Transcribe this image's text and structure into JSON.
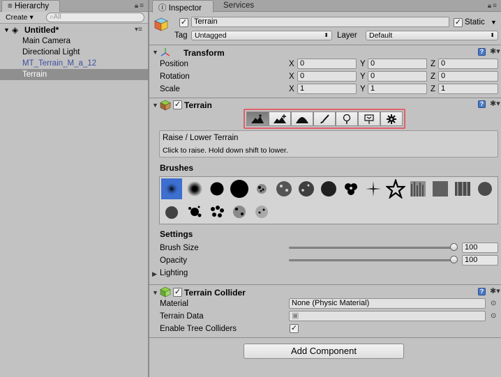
{
  "hierarchy": {
    "tab_label": "Hierarchy",
    "create_label": "Create",
    "create_arrow": "▾",
    "search_placeholder": "All",
    "scene_name": "Untitled*",
    "items": [
      {
        "label": "Main Camera"
      },
      {
        "label": "Directional Light"
      },
      {
        "label": "MT_Terrain_M_a_12"
      },
      {
        "label": "Terrain"
      }
    ]
  },
  "inspector": {
    "tabs": [
      "Inspector",
      "Services"
    ],
    "object_name": "Terrain",
    "active_checked": "✓",
    "static_label": "Static",
    "static_checked": "✓",
    "tag_label": "Tag",
    "tag_value": "Untagged",
    "layer_label": "Layer",
    "layer_value": "Default",
    "transform": {
      "title": "Transform",
      "rows": [
        {
          "label": "Position",
          "x": "0",
          "y": "0",
          "z": "0"
        },
        {
          "label": "Rotation",
          "x": "0",
          "y": "0",
          "z": "0"
        },
        {
          "label": "Scale",
          "x": "1",
          "y": "1",
          "z": "1"
        }
      ],
      "axis_x": "X",
      "axis_y": "Y",
      "axis_z": "Z"
    },
    "terrain": {
      "title": "Terrain",
      "enabled_checked": "✓",
      "tools": [
        "raise-lower-terrain",
        "paint-height",
        "smooth-height",
        "paint-texture",
        "place-trees",
        "paint-details",
        "terrain-settings"
      ],
      "active_tool": 0,
      "tool_name": "Raise / Lower Terrain",
      "tool_hint": "Click to raise. Hold down shift to lower.",
      "brushes_label": "Brushes",
      "settings_label": "Settings",
      "brush_size_label": "Brush Size",
      "brush_size_value": "100",
      "brush_size_fraction": 1.0,
      "opacity_label": "Opacity",
      "opacity_value": "100",
      "opacity_fraction": 1.0,
      "lighting_label": "Lighting"
    },
    "terrain_collider": {
      "title": "Terrain Collider",
      "enabled_checked": "✓",
      "material_label": "Material",
      "material_value": "None (Physic Material)",
      "terrain_data_label": "Terrain Data",
      "terrain_data_value": "",
      "tree_colliders_label": "Enable Tree Colliders",
      "tree_colliders_checked": "✓"
    },
    "add_component_label": "Add Component"
  },
  "colors": {
    "panel_bg": "#c2c2c2",
    "selected_row": "#8f8f8f",
    "prefab_text": "#3d4fa0",
    "tool_highlight": "#e0606a",
    "brush_selected": "#3c6fd0"
  }
}
